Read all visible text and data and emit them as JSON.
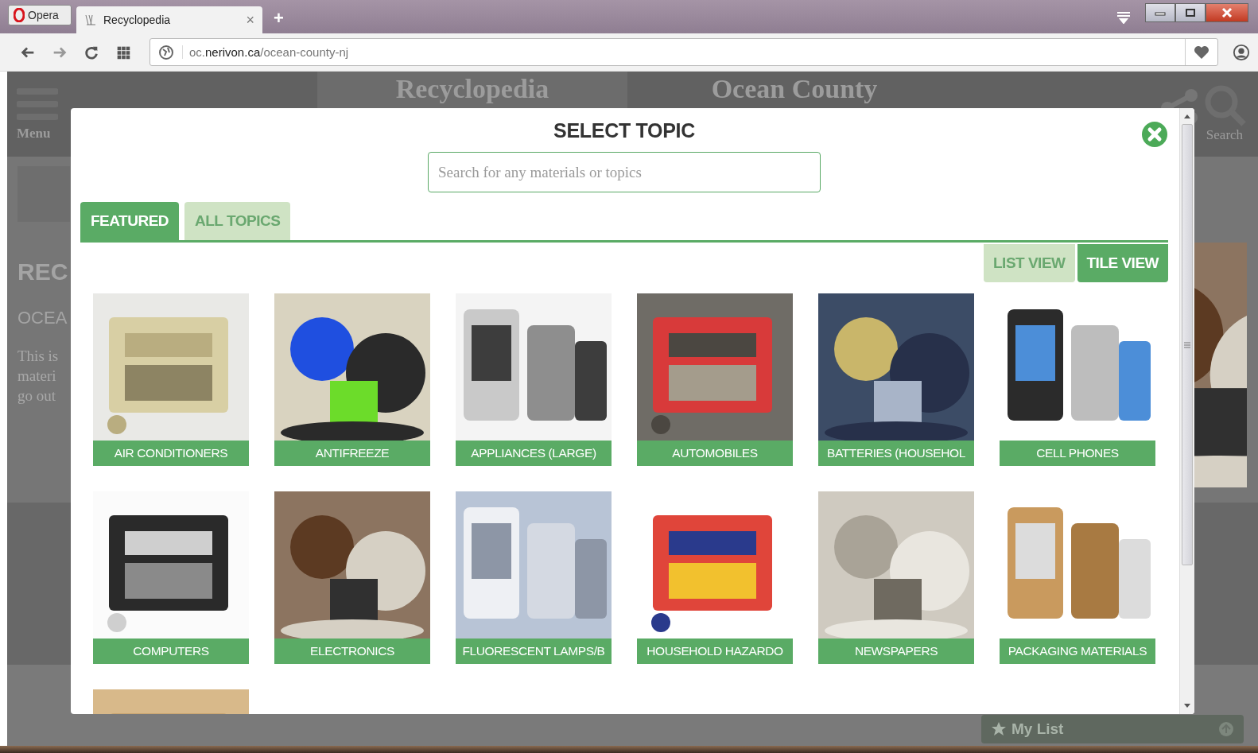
{
  "browser": {
    "menu_label": "Opera",
    "tab": {
      "title": "Recyclopedia",
      "close": "×"
    },
    "new_tab": "+",
    "url": {
      "prefix": "oc.",
      "domain": "nerivon.ca",
      "path": "/ocean-county-nj"
    }
  },
  "site": {
    "menu_label": "Menu",
    "title": "Recyclopedia",
    "county": "Ocean County",
    "search_label": "Search",
    "heading": "REC",
    "subheading": "OCEA",
    "intro_lines": [
      "This is",
      "materi",
      "go out"
    ],
    "my_list": "My List"
  },
  "modal": {
    "title": "SELECT TOPIC",
    "search": {
      "placeholder": "Search for any materials or topics"
    },
    "tabs": [
      {
        "label": "FEATURED",
        "selected": true
      },
      {
        "label": "ALL TOPICS",
        "selected": false
      }
    ],
    "views": [
      {
        "label": "LIST VIEW",
        "selected": false
      },
      {
        "label": "TILE VIEW",
        "selected": true
      }
    ],
    "tiles": [
      {
        "label": "AIR CONDITIONERS",
        "kind": "picture"
      },
      {
        "label": "ANTIFREEZE",
        "kind": "picture"
      },
      {
        "label": "APPLIANCES (LARGE)",
        "kind": "picture"
      },
      {
        "label": "AUTOMOBILES",
        "kind": "picture"
      },
      {
        "label": "BATTERIES (HOUSEHOL",
        "kind": "picture"
      },
      {
        "label": "CELL PHONES",
        "kind": "picture"
      },
      {
        "label": "COMPUTERS",
        "kind": "picture"
      },
      {
        "label": "ELECTRONICS",
        "kind": "picture"
      },
      {
        "label": "FLUORESCENT LAMPS/B",
        "kind": "picture"
      },
      {
        "label": "HOUSEHOLD HAZARDO",
        "kind": "picture"
      },
      {
        "label": "NEWSPAPERS",
        "kind": "picture"
      },
      {
        "label": "PACKAGING MATERIALS",
        "kind": "picture"
      },
      {
        "kind": "picture"
      }
    ]
  }
}
